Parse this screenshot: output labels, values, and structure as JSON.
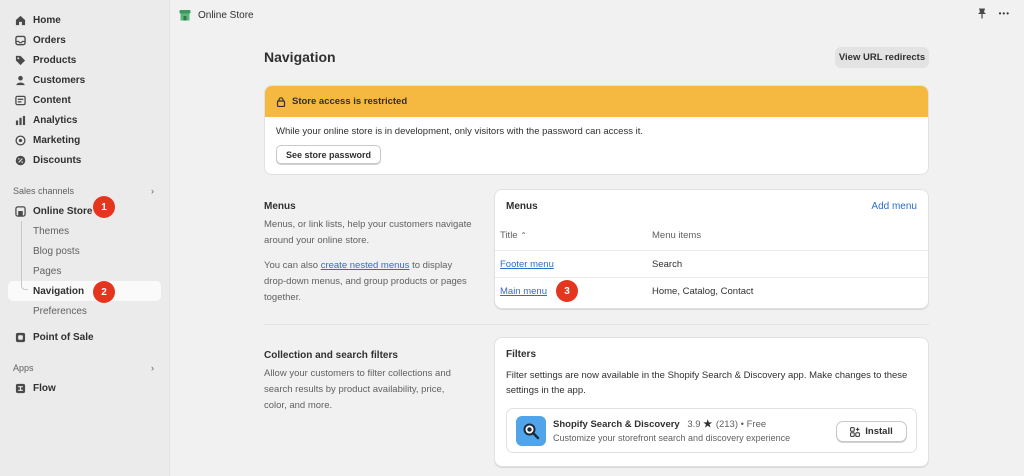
{
  "sidebar": {
    "items": [
      {
        "label": "Home",
        "icon": "home-icon"
      },
      {
        "label": "Orders",
        "icon": "inbox-icon"
      },
      {
        "label": "Products",
        "icon": "tag-icon"
      },
      {
        "label": "Customers",
        "icon": "person-icon"
      },
      {
        "label": "Content",
        "icon": "content-icon"
      },
      {
        "label": "Analytics",
        "icon": "chart-icon"
      },
      {
        "label": "Marketing",
        "icon": "target-icon"
      },
      {
        "label": "Discounts",
        "icon": "discount-icon"
      }
    ],
    "sales_channels_label": "Sales channels",
    "online_store_label": "Online Store",
    "sub_items": [
      "Themes",
      "Blog posts",
      "Pages",
      "Navigation",
      "Preferences"
    ],
    "point_of_sale_label": "Point of Sale",
    "apps_label": "Apps",
    "flow_label": "Flow"
  },
  "badges": [
    "1",
    "2",
    "3"
  ],
  "topbar": {
    "title": "Online Store",
    "more": "•••"
  },
  "main": {
    "title": "Navigation",
    "redirects_button": "View URL redirects",
    "banner": {
      "title": "Store access is restricted",
      "body": "While your online store is in development, only visitors with the password can access it.",
      "button": "See store password"
    },
    "menus_section": {
      "title": "Menus",
      "desc1": "Menus, or link lists, help your customers navigate around your online store.",
      "desc2_pre": "You can also ",
      "desc2_link": "create nested menus",
      "desc2_post": " to display drop-down menus, and group products or pages together."
    },
    "menus_card": {
      "title": "Menus",
      "add_link": "Add menu",
      "col_title": "Title",
      "col_items": "Menu items",
      "rows": [
        {
          "title": "Footer menu",
          "items": "Search"
        },
        {
          "title": "Main menu",
          "items": "Home, Catalog, Contact"
        }
      ]
    },
    "filters_section": {
      "title": "Collection and search filters",
      "desc": "Allow your customers to filter collections and search results by product availability, price, color, and more."
    },
    "filters_card": {
      "title": "Filters",
      "text": "Filter settings are now available in the Shopify Search & Discovery app. Make changes to these settings in the app.",
      "app_name": "Shopify Search & Discovery",
      "app_rating": "3.9",
      "app_reviews": "(213) • Free",
      "app_desc": "Customize your storefront search and discovery experience",
      "install_button": "Install"
    }
  },
  "colors": {
    "accent": "#2c6ecb",
    "warning": "#f5b942",
    "badge": "#e4361f"
  }
}
